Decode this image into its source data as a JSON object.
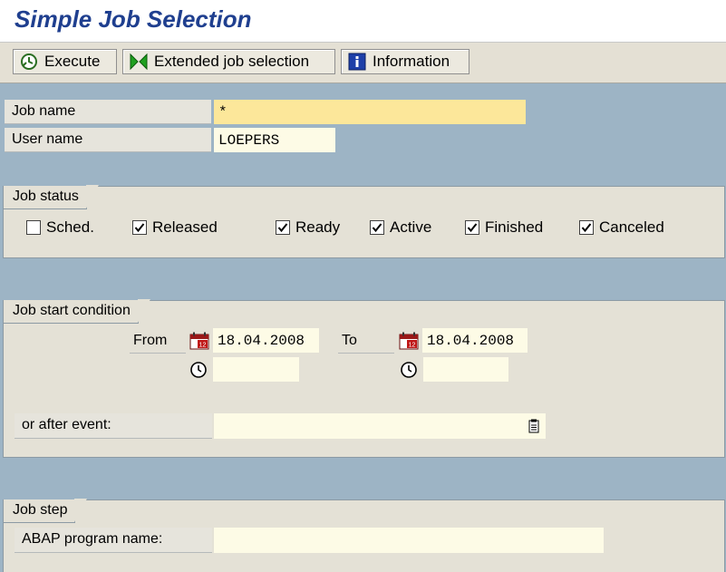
{
  "window": {
    "title": "Simple Job Selection"
  },
  "toolbar": {
    "execute_label": "Execute",
    "extended_label": "Extended job selection",
    "information_label": "Information"
  },
  "criteria": {
    "job_name_label": "Job name",
    "job_name_value": "*",
    "user_name_label": "User name",
    "user_name_value": "LOEPERS"
  },
  "job_status": {
    "title": "Job status",
    "items": [
      {
        "label": "Sched.",
        "checked": false
      },
      {
        "label": "Released",
        "checked": true
      },
      {
        "label": "Ready",
        "checked": true
      },
      {
        "label": "Active",
        "checked": true
      },
      {
        "label": "Finished",
        "checked": true
      },
      {
        "label": "Canceled",
        "checked": true
      }
    ]
  },
  "start_condition": {
    "title": "Job start condition",
    "from_label": "From",
    "from_date": "18.04.2008",
    "from_time": "",
    "to_label": "To",
    "to_date": "18.04.2008",
    "to_time": "",
    "event_label": "or after event:",
    "event_value": ""
  },
  "job_step": {
    "title": "Job step",
    "abap_label": "ABAP program name:",
    "abap_value": ""
  }
}
